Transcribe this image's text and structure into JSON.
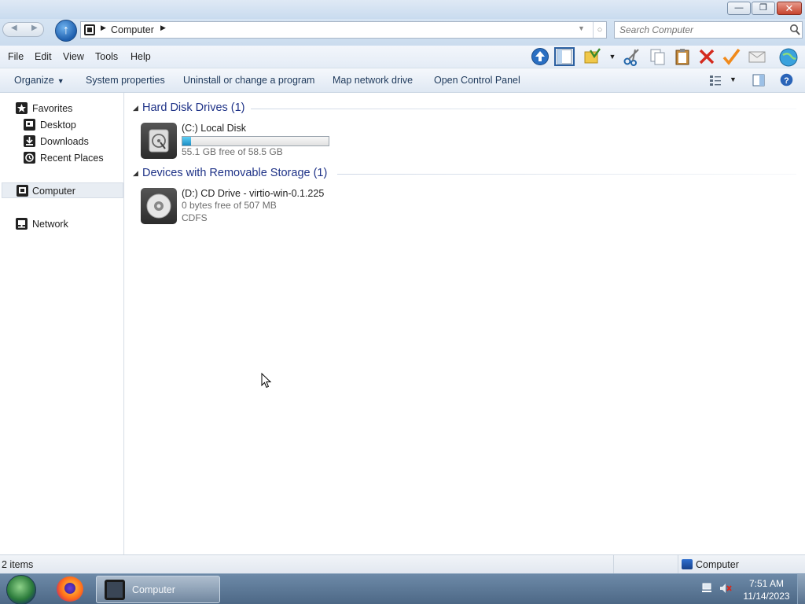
{
  "address": {
    "crumbs": [
      "Computer"
    ]
  },
  "search": {
    "placeholder": "Search Computer"
  },
  "menu": [
    "File",
    "Edit",
    "View",
    "Tools",
    "Help"
  ],
  "toolbar_icons": [
    "up-arrow-icon",
    "pane-icon",
    "folder-options-icon",
    "dropdown-arrow",
    "cut-icon",
    "copy-icon",
    "paste-icon",
    "delete-icon",
    "checkmark-icon",
    "mail-icon",
    "globe-icon"
  ],
  "commands": {
    "organize": "Organize",
    "system_properties": "System properties",
    "uninstall": "Uninstall or change a program",
    "map_drive": "Map network drive",
    "control_panel": "Open Control Panel"
  },
  "sidebar": {
    "favorites": "Favorites",
    "desktop": "Desktop",
    "downloads": "Downloads",
    "recent": "Recent Places",
    "computer": "Computer",
    "network": "Network"
  },
  "groups": [
    {
      "title": "Hard Disk Drives (1)",
      "drives": [
        {
          "name": "(C:) Local Disk",
          "free_text": "55.1 GB free of 58.5 GB",
          "used_fraction": 0.058
        }
      ]
    },
    {
      "title": "Devices with Removable Storage (1)",
      "drives": [
        {
          "name": "(D:) CD Drive - virtio-win-0.1.225",
          "free_text": "0 bytes free of 507 MB",
          "fs": "CDFS"
        }
      ]
    }
  ],
  "status": {
    "count": "2 items",
    "zone": "Computer"
  },
  "taskbar": {
    "window_label": "Computer",
    "time": "7:51 AM",
    "date": "11/14/2023"
  },
  "colors": {
    "group_title": "#1e3287",
    "command_text": "#1e395b",
    "capacity_fill": "#1c8cc4"
  }
}
